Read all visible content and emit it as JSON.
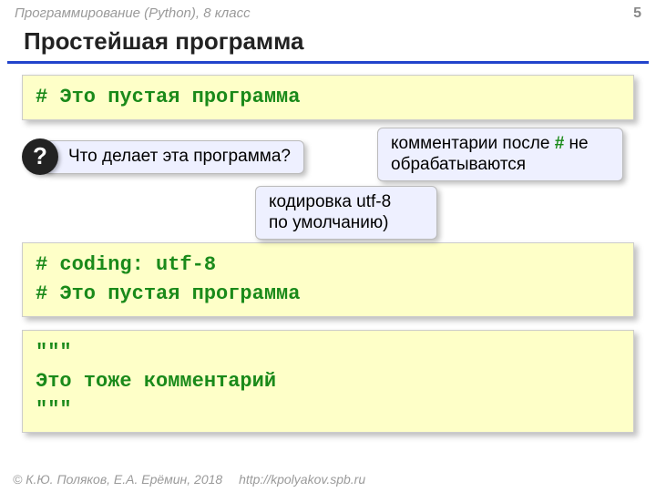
{
  "header": {
    "course": "Программирование (Python), 8 класс",
    "page": "5"
  },
  "title": "Простейшая программа",
  "code1": {
    "line1": "# Это пустая программа"
  },
  "qbadge": "?",
  "callout1": "Что делает эта программа?",
  "callout2_pre": "комментарии после ",
  "callout2_hash": "#",
  "callout2_post": " не обрабатываются",
  "callout3_l1": "кодировка utf-8",
  "callout3_l2": "по умолчанию)",
  "code2": {
    "line1": "# coding: utf-8",
    "line2": "# Это пустая программа"
  },
  "code3": {
    "line1": "\"\"\"",
    "line2": "Это тоже комментарий",
    "line3": "\"\"\""
  },
  "footer": {
    "copyright": "© К.Ю. Поляков, Е.А. Ерёмин, 2018",
    "link": "http://kpolyakov.spb.ru"
  }
}
